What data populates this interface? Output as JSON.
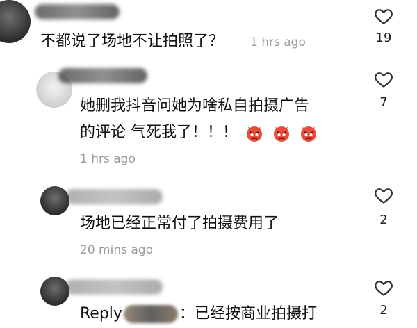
{
  "comments": [
    {
      "text": "不都说了场地不让拍照了？",
      "time": "1 hrs ago",
      "likes": "19"
    },
    {
      "text_line1": "她删我抖音问她为啥私自拍摄广告",
      "text_line2": "的评论 气死我了！！！",
      "emojis": [
        "angry-devil-emoji",
        "angry-devil-emoji",
        "angry-devil-emoji"
      ],
      "time": "1 hrs ago",
      "likes": "7"
    },
    {
      "text": "场地已经正常付了拍摄费用了",
      "time": "20 mins ago",
      "likes": "2"
    },
    {
      "reply_label": "Reply",
      "text": "：已经按商业拍摄打",
      "likes": "2"
    }
  ],
  "icons": {
    "like": "heart-outline-icon"
  },
  "colors": {
    "text": "#111111",
    "muted": "#9a9a9a",
    "background": "#ffffff"
  }
}
